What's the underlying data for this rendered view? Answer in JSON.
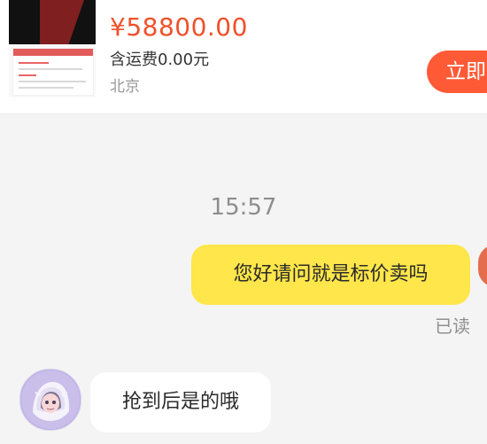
{
  "product": {
    "price": "¥58800.00",
    "shipping": "含运费0.00元",
    "location": "北京",
    "buy_button": "立即"
  },
  "chat": {
    "timestamp": "15:57",
    "messages": [
      {
        "text": "您好请问就是标价卖吗",
        "status": "已读"
      },
      {
        "text": "抢到后是的哦"
      }
    ]
  },
  "colors": {
    "price": "#f0502a",
    "accent": "#ff5a36",
    "outgoing_bubble": "#ffe64a",
    "incoming_bubble": "#ffffff",
    "background": "#f4f4f4"
  }
}
